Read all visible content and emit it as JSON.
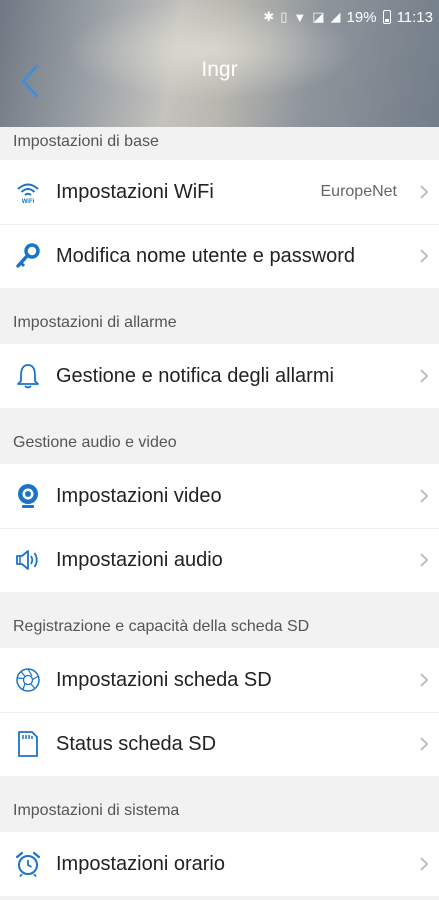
{
  "status_bar": {
    "battery": "19%",
    "time": "11:13",
    "icons": [
      "bluetooth-icon",
      "vibrate-icon",
      "wifi-icon",
      "no-sim-icon",
      "signal-icon",
      "battery-icon"
    ]
  },
  "header": {
    "title": "Ingr",
    "back_icon": "chevron-left-icon"
  },
  "sections": [
    {
      "title": "Impostazioni di base",
      "items": [
        {
          "label": "Impostazioni WiFi",
          "value": "EuropeNet",
          "icon": "wifi-icon"
        },
        {
          "label": "Modifica nome utente e password",
          "icon": "key-icon"
        }
      ]
    },
    {
      "title": "Impostazioni di allarme",
      "items": [
        {
          "label": "Gestione e notifica degli allarmi",
          "icon": "bell-icon"
        }
      ]
    },
    {
      "title": "Gestione audio e video",
      "items": [
        {
          "label": "Impostazioni video",
          "icon": "webcam-icon"
        },
        {
          "label": "Impostazioni audio",
          "icon": "speaker-icon"
        }
      ]
    },
    {
      "title": "Registrazione e capacità della scheda SD",
      "items": [
        {
          "label": "Impostazioni scheda SD",
          "icon": "aperture-icon"
        },
        {
          "label": "Status scheda SD",
          "icon": "sd-card-icon"
        }
      ]
    },
    {
      "title": "Impostazioni di sistema",
      "items": [
        {
          "label": "Impostazioni orario",
          "icon": "alarm-clock-icon"
        }
      ]
    }
  ],
  "colors": {
    "accent": "#1a73c9",
    "chevron": "#b5b5b5",
    "section_bg": "#f2f2f2"
  }
}
